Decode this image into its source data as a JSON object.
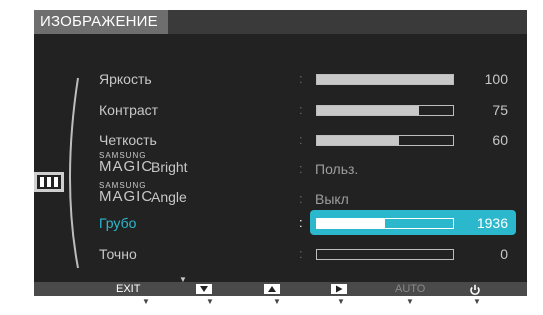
{
  "header": {
    "title": "ИЗОБРАЖЕНИЕ"
  },
  "menu": {
    "items": [
      {
        "label": "Яркость",
        "value": "100",
        "level": 1.0
      },
      {
        "label": "Контраст",
        "value": "75",
        "level": 0.75
      },
      {
        "label": "Четкость",
        "value": "60",
        "level": 0.6
      },
      {
        "brand_small": "SAMSUNG",
        "brand_big": "MAGIC",
        "label": "Bright",
        "value": "Польз."
      },
      {
        "brand_small": "SAMSUNG",
        "brand_big": "MAGIC",
        "label": "Angle",
        "value": "Выкл"
      },
      {
        "label": "Грубо",
        "value": "1936",
        "level": 0.5,
        "selected": true
      },
      {
        "label": "Точно",
        "value": "0",
        "level": 0.0
      }
    ],
    "separator": ":"
  },
  "keybar": {
    "exit": "EXIT",
    "auto": "AUTO"
  },
  "colors": {
    "accent": "#2cb8cc",
    "osd_background": "#222222",
    "title_tab": "#6e6e6e",
    "keybar": "#4a4a4a"
  },
  "icons": {
    "category": "picture-category-icon",
    "down": "down-arrow-icon",
    "up": "up-arrow-icon",
    "enter": "enter-icon",
    "power": "power-icon",
    "scroll": "scroll-down-icon"
  }
}
